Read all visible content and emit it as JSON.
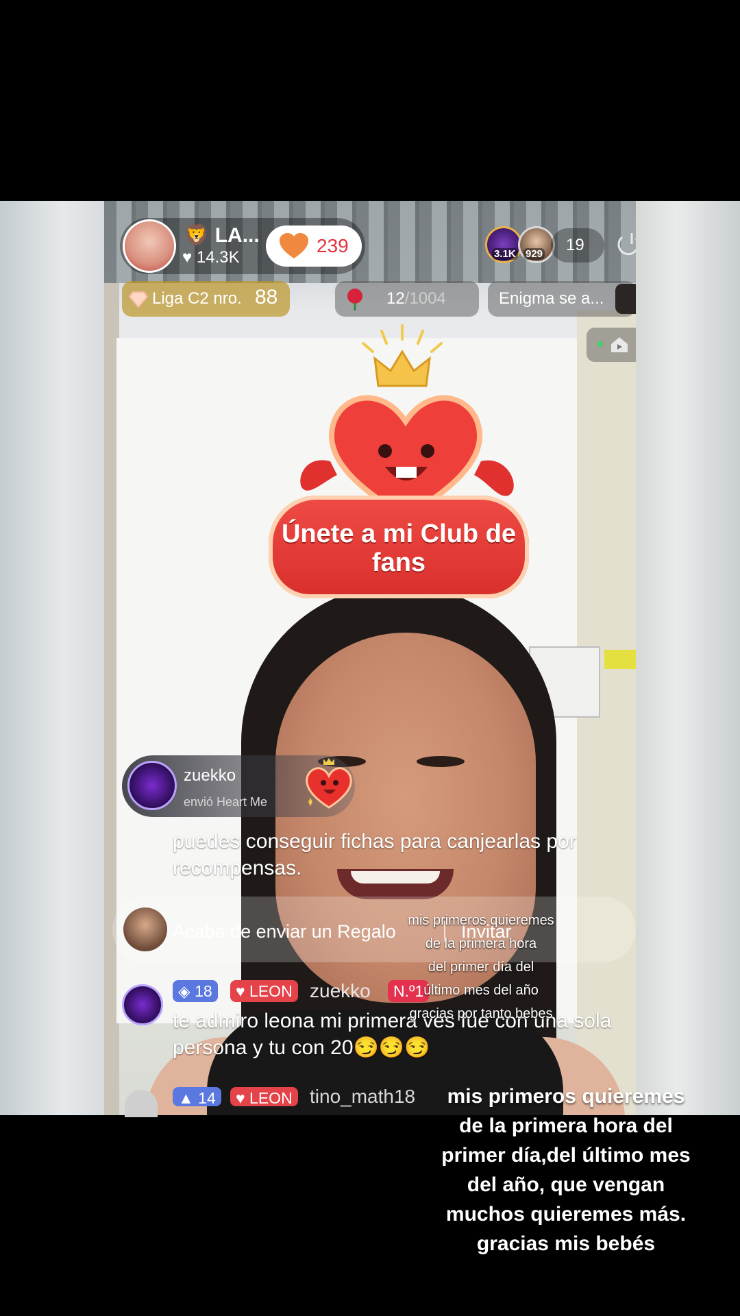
{
  "host": {
    "name": "LA...",
    "likes": "14.3K",
    "fan_count": "239"
  },
  "viewers": {
    "top1_score": "3.1K",
    "top2_score": "929",
    "count": "19"
  },
  "info_pills": {
    "league_label": "Liga C2 nro.",
    "league_number": "88",
    "goal_current": "12",
    "goal_total": "/1004",
    "enigma": "Enigma se a..."
  },
  "fan_club": {
    "line1": "Únete a mi Club de",
    "line2": "fans"
  },
  "gift": {
    "user": "zuekko",
    "subtitle": "envió Heart Me"
  },
  "comments": {
    "system_text": "puedes conseguir fichas para canjearlas por recompensas.",
    "join_text": "Acaba de enviar un Regalo",
    "invite_label": "Invitar",
    "user_comment": {
      "level": "18",
      "fan_badge": "LEON",
      "username": "zuekko",
      "rank": "N.º1",
      "text": "te admiro leona mi primera ves fue con una sola persona y tu con 20😏😏😏"
    },
    "next_comment": {
      "level": "14",
      "fan_badge": "LEON",
      "username": "tino_math18"
    }
  },
  "captions": {
    "small": [
      "mis primeros quieremes",
      "de la primera hora",
      "del primer día del",
      "último mes del año",
      "gracias por tanto bebes"
    ],
    "big": [
      "mis primeros quieremes",
      "de la primera hora del",
      "primer día,del último mes",
      "del año, que vengan",
      "muchos quieremes más.",
      "gracias mis bebés"
    ]
  },
  "colors": {
    "accent_red": "#e5323d",
    "league_gold": "#bc9628",
    "level_blue": "#5b78e0"
  },
  "icons": [
    "heart-icon",
    "lion-emoji-icon",
    "power-icon",
    "diamond-icon",
    "rose-icon",
    "share-screen-icon",
    "crown-icon"
  ]
}
